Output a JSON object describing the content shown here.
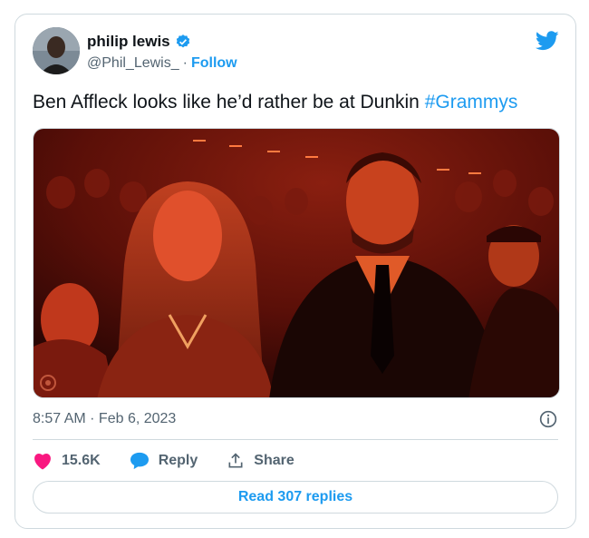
{
  "user": {
    "name": "philip lewis",
    "handle": "@Phil_Lewis_",
    "separator": "·",
    "follow_label": "Follow"
  },
  "tweet": {
    "text": "Ben Affleck looks like he’d rather be at Dunkin ",
    "hashtag": "#Grammys",
    "timestamp": "8:57 AM · Feb 6, 2023"
  },
  "actions": {
    "likes": "15.6K",
    "reply_label": "Reply",
    "share_label": "Share"
  },
  "read_replies_label": "Read 307 replies",
  "colors": {
    "accent": "#1d9bf0",
    "like": "#f91880",
    "border": "#cfd9de",
    "muted": "#536471",
    "text": "#0f1419"
  },
  "icons": [
    "verified-badge-icon",
    "twitter-bird-icon",
    "info-icon",
    "heart-icon",
    "reply-bubble-icon",
    "share-icon"
  ]
}
